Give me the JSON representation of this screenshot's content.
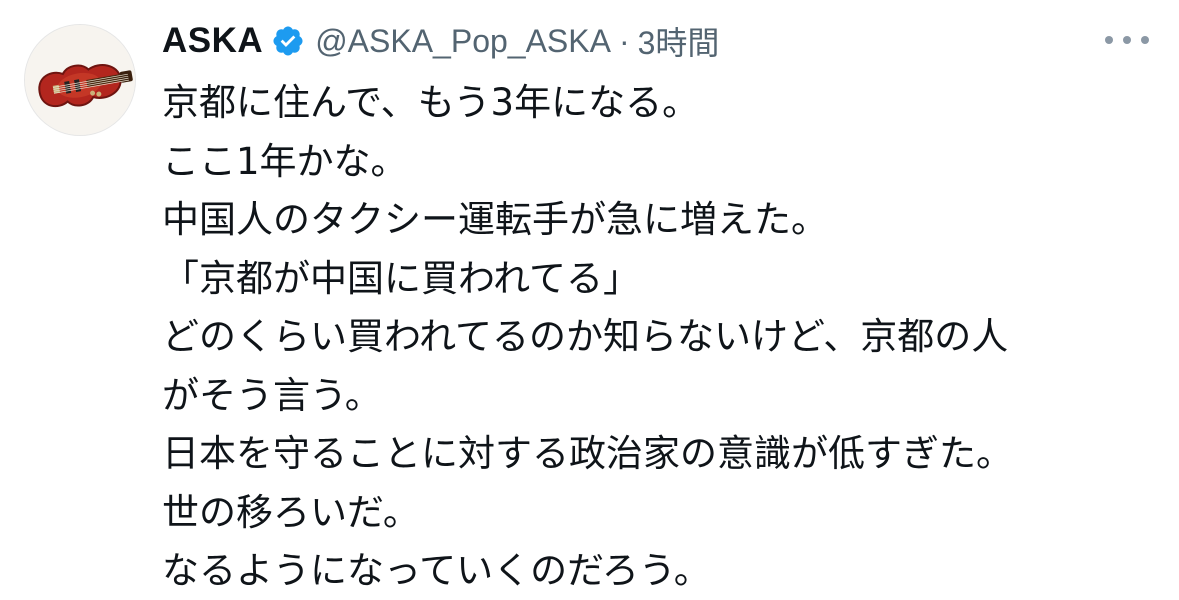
{
  "tweet": {
    "display_name": "ASKA",
    "handle": "@ASKA_Pop_ASKA",
    "separator": "·",
    "timestamp": "3時間",
    "avatar_icon": "violin-bass-icon",
    "verified_icon": "verified-badge-icon",
    "more_icon": "more-options-icon",
    "verified_color": "#1d9bf0",
    "lines": [
      "京都に住んで、もう3年になる。",
      "ここ1年かな。",
      "中国人のタクシー運転手が急に増えた。",
      "「京都が中国に買われてる」",
      "どのくらい買われてるのか知らないけど、京都の人",
      "がそう言う。",
      "日本を守ることに対する政治家の意識が低すぎた。",
      "世の移ろいだ。",
      "なるようになっていくのだろう。"
    ]
  }
}
